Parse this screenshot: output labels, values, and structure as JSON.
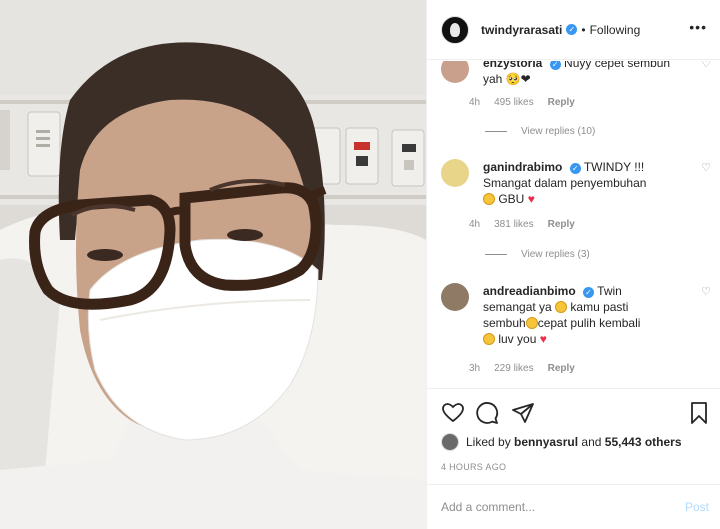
{
  "post": {
    "username": "twindyrarasati",
    "verified": true,
    "separator": "•",
    "follow_status": "Following",
    "more_icon": "more-options-icon",
    "colors": {
      "accent": "#3897f0",
      "heart": "#ed2e4a",
      "muted": "#8e8e8e",
      "post_disabled": "#b3dbff"
    }
  },
  "comments": [
    {
      "username": "enzystoria",
      "verified": true,
      "text": "Nuyy cepet sembuh yah",
      "emoji": "🥺❤",
      "time": "4h",
      "likes": "495 likes",
      "reply": "Reply",
      "view_replies": "View replies (10)"
    },
    {
      "username": "ganindrabimo",
      "verified": true,
      "text_line1": "TWINDY !!!",
      "text_line2": "Smangat dalam penyembuhan",
      "text_line3": "GBU",
      "time": "4h",
      "likes": "381 likes",
      "reply": "Reply",
      "view_replies": "View replies (3)"
    },
    {
      "username": "andreadianbimo",
      "verified": true,
      "text_a": "Twin",
      "text_b": "semangat ya",
      "text_c": "kamu pasti",
      "text_d": "sembuh",
      "text_e": "cepat pulih kembali",
      "text_f": "luv you",
      "time": "3h",
      "likes": "229 likes",
      "reply": "Reply"
    }
  ],
  "actions": {
    "like_icon": "heart-outline-icon",
    "comment_icon": "comment-bubble-icon",
    "share_icon": "paper-plane-icon",
    "save_icon": "bookmark-icon"
  },
  "liked_by": {
    "prefix": "Liked by",
    "user": "bennyasrul",
    "conjunction": "and",
    "others": "55,443 others"
  },
  "timestamp": "4 HOURS AGO",
  "add_comment": {
    "placeholder": "Add a comment...",
    "post_label": "Post"
  }
}
